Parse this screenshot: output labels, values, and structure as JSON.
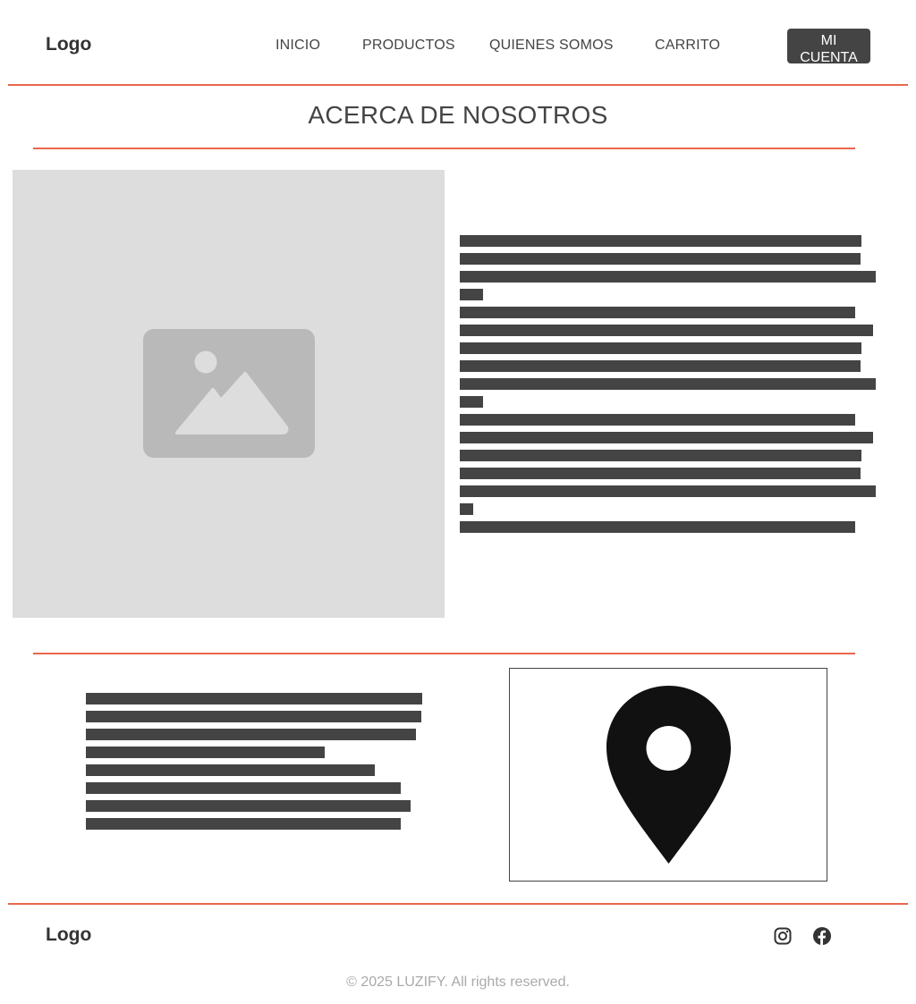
{
  "header": {
    "logo": "Logo",
    "nav": [
      {
        "label": "INICIO"
      },
      {
        "label": "PRODUCTOS"
      },
      {
        "label": "QUIENES SOMOS"
      },
      {
        "label": "CARRITO"
      }
    ],
    "account_button": "MI CUENTA"
  },
  "main": {
    "title": "ACERCA DE NOSOTROS",
    "image_icon": "image-placeholder-icon",
    "map_icon": "map-pin-icon"
  },
  "footer": {
    "logo": "Logo",
    "social": [
      {
        "icon": "instagram-icon"
      },
      {
        "icon": "facebook-icon"
      }
    ],
    "copyright": "© 2025 LUZIFY. All rights reserved."
  },
  "colors": {
    "accent": "#e8674a",
    "text": "#444444",
    "placeholder_bg": "#dddddd",
    "placeholder_icon": "#b9b9b9",
    "button_bg": "#444444",
    "muted": "#aaaaaa"
  }
}
